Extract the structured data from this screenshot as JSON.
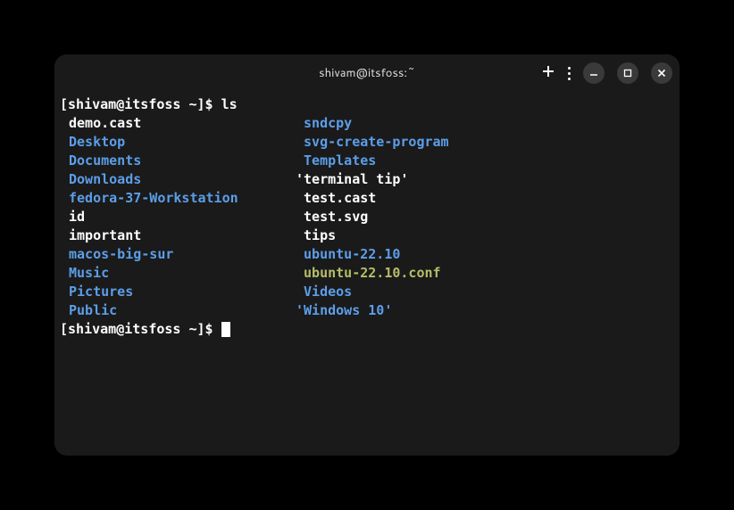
{
  "window": {
    "title": "shivam@itsfoss:~"
  },
  "prompt": {
    "user": "shivam",
    "host": "itsfoss",
    "path": "~",
    "command": "ls"
  },
  "ls": {
    "col1": [
      {
        "name": "demo.cast",
        "type": "file"
      },
      {
        "name": "Desktop",
        "type": "dir"
      },
      {
        "name": "Documents",
        "type": "dir"
      },
      {
        "name": "Downloads",
        "type": "dir"
      },
      {
        "name": "fedora-37-Workstation",
        "type": "dir"
      },
      {
        "name": "id",
        "type": "file"
      },
      {
        "name": "important",
        "type": "file"
      },
      {
        "name": "macos-big-sur",
        "type": "dir"
      },
      {
        "name": "Music",
        "type": "dir"
      },
      {
        "name": "Pictures",
        "type": "dir"
      },
      {
        "name": "Public",
        "type": "dir"
      }
    ],
    "col2": [
      {
        "name": " sndcpy",
        "type": "dir"
      },
      {
        "name": " svg-create-program",
        "type": "dir"
      },
      {
        "name": " Templates",
        "type": "dir"
      },
      {
        "name": "'terminal tip'",
        "type": "file"
      },
      {
        "name": " test.cast",
        "type": "file"
      },
      {
        "name": " test.svg",
        "type": "file"
      },
      {
        "name": " tips",
        "type": "file"
      },
      {
        "name": " ubuntu-22.10",
        "type": "dir"
      },
      {
        "name": " ubuntu-22.10.conf",
        "type": "archive"
      },
      {
        "name": " Videos",
        "type": "dir"
      },
      {
        "name": "'Windows 10'",
        "type": "dir"
      }
    ]
  }
}
